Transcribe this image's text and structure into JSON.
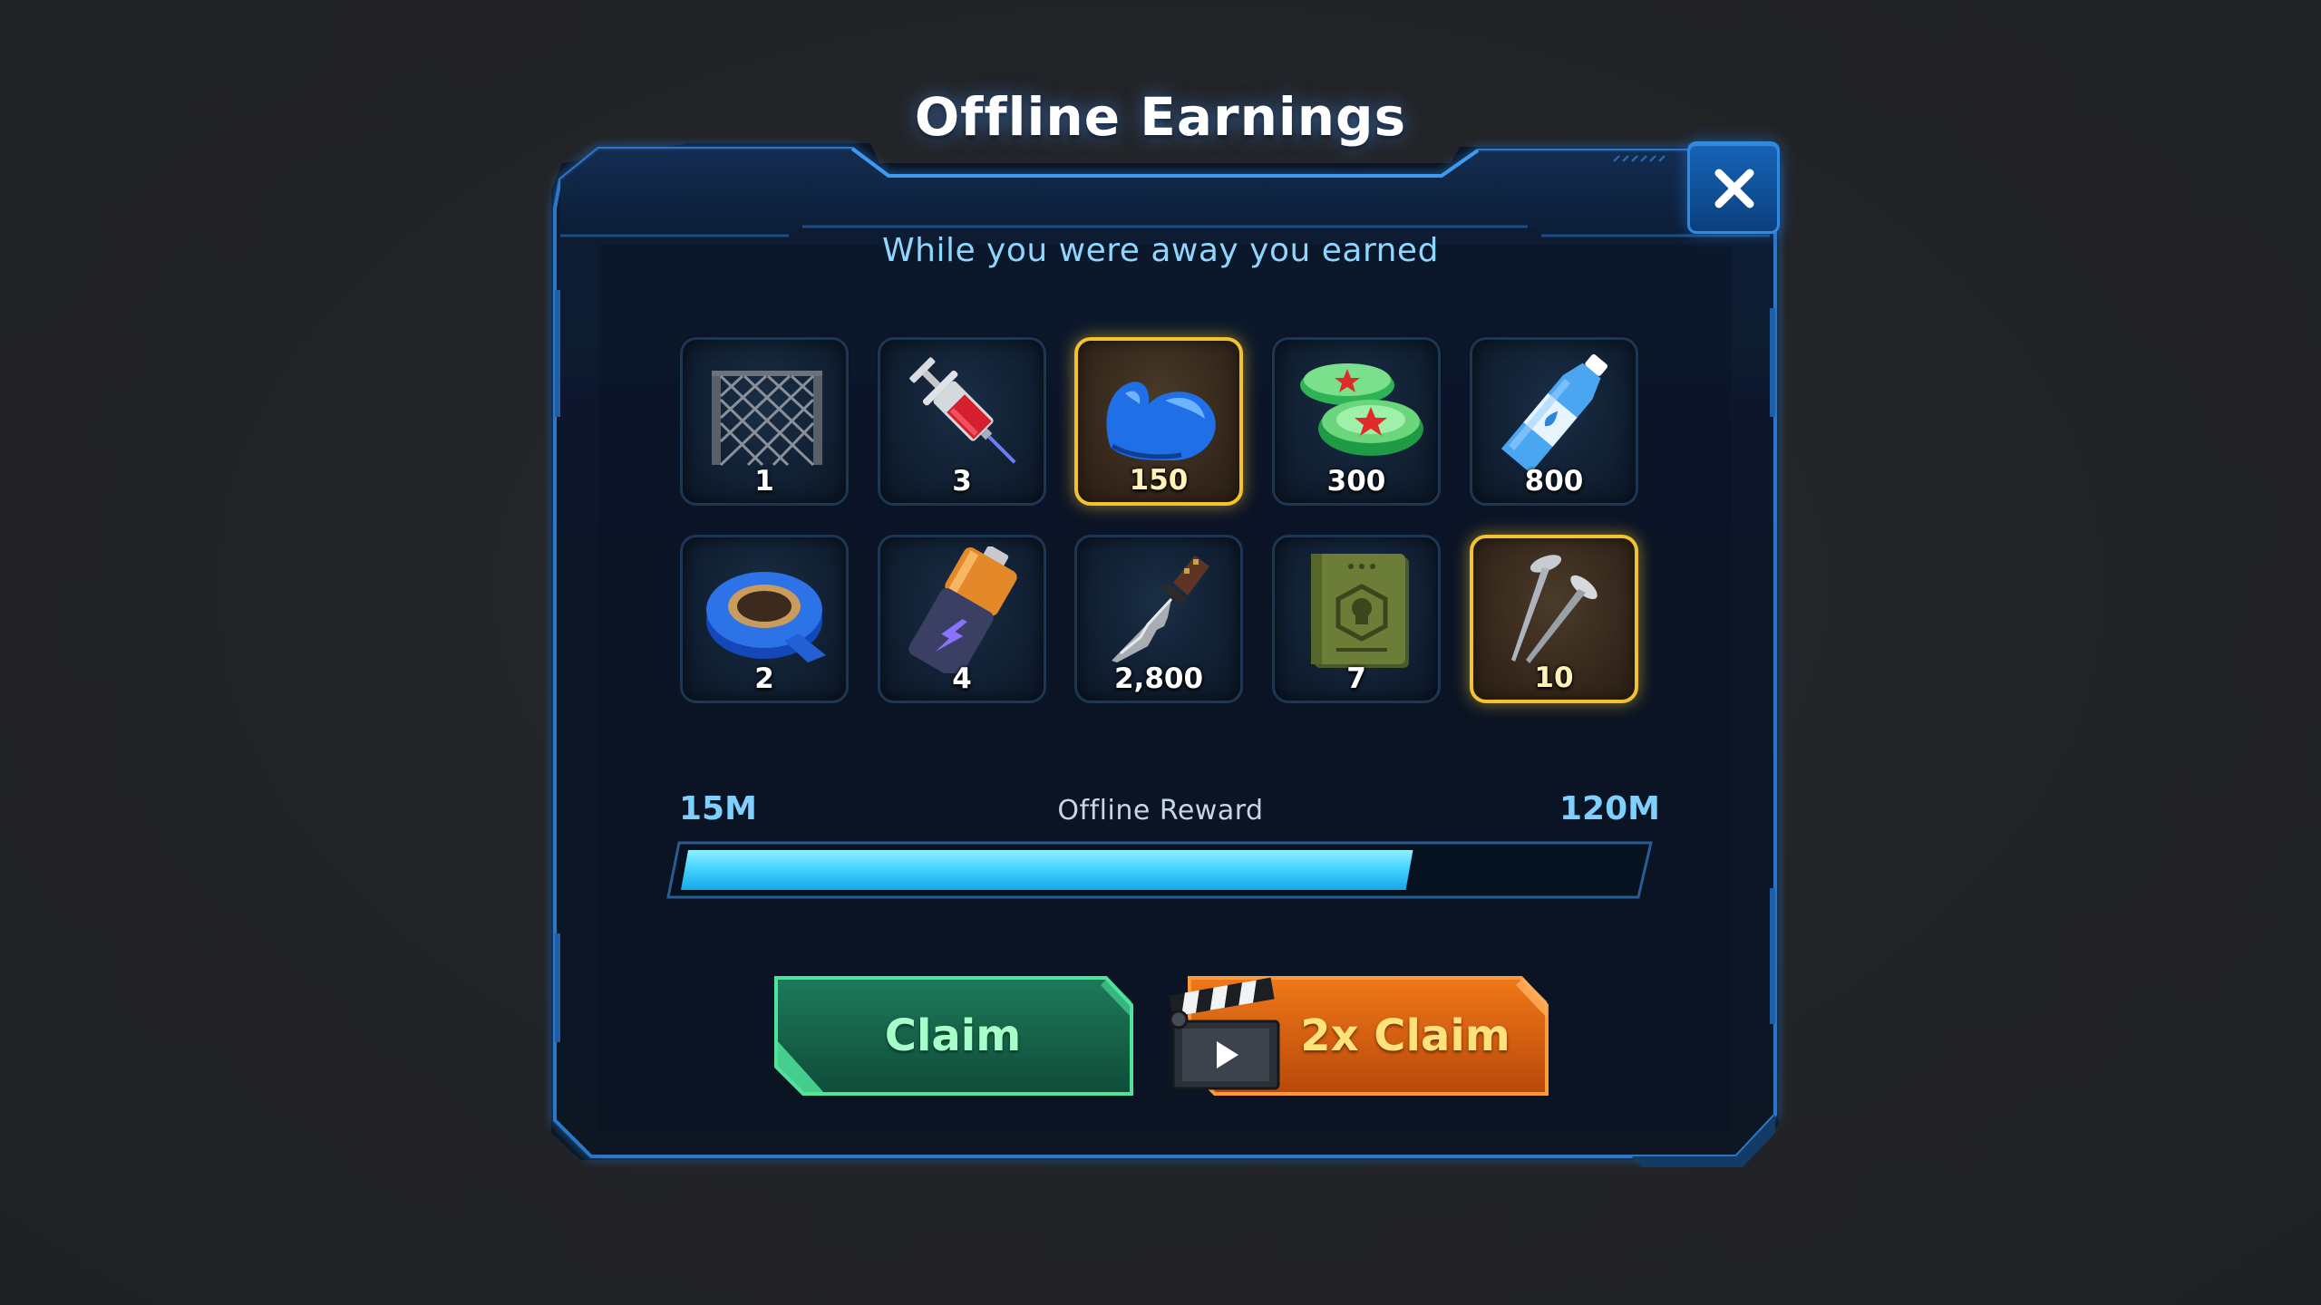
{
  "dialog": {
    "title": "Offline Earnings",
    "subtitle": "While you were away you earned"
  },
  "close": {
    "icon": "close-icon"
  },
  "rewards": [
    {
      "name": "fence",
      "icon": "chain-link-fence-icon",
      "qty": "1",
      "highlight": false
    },
    {
      "name": "syringe",
      "icon": "syringe-icon",
      "qty": "3",
      "highlight": false
    },
    {
      "name": "muscle",
      "icon": "flexed-bicep-icon",
      "qty": "150",
      "highlight": true
    },
    {
      "name": "bottle-caps",
      "icon": "bottle-cap-icon",
      "qty": "300",
      "highlight": false
    },
    {
      "name": "water",
      "icon": "water-bottle-icon",
      "qty": "800",
      "highlight": false
    },
    {
      "name": "tape",
      "icon": "duct-tape-icon",
      "qty": "2",
      "highlight": false
    },
    {
      "name": "battery",
      "icon": "battery-icon",
      "qty": "4",
      "highlight": false
    },
    {
      "name": "knife",
      "icon": "combat-knife-icon",
      "qty": "2,800",
      "highlight": false
    },
    {
      "name": "manual",
      "icon": "skull-book-icon",
      "qty": "7",
      "highlight": false
    },
    {
      "name": "nails",
      "icon": "nails-icon",
      "qty": "10",
      "highlight": true
    }
  ],
  "progress": {
    "min_label": "15M",
    "max_label": "120M",
    "label": "Offline Reward",
    "fill": 0.76
  },
  "buttons": {
    "claim_label": "Claim",
    "double_claim_label": "2x Claim",
    "double_claim_icon": "video-clapperboard-icon"
  },
  "colors": {
    "panel_bg": "#0b1729",
    "panel_border": "#2f7fd4",
    "accent_cyan": "#3fd0ff",
    "claim_green": "#15634a",
    "claim2x_orange": "#e46510",
    "gold": "#f2c230"
  }
}
